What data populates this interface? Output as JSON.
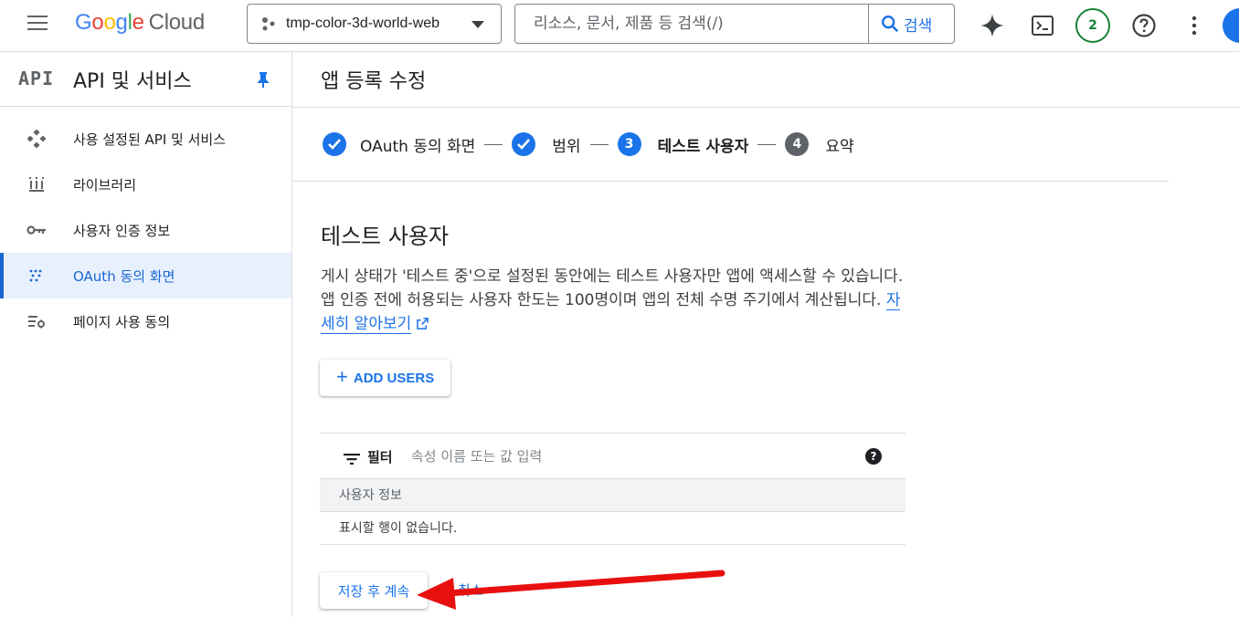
{
  "header": {
    "logo_google": "Google",
    "logo_cloud": "Cloud",
    "project_name": "tmp-color-3d-world-web",
    "search_placeholder": "리소스, 문서, 제품 등 검색(/)",
    "search_button": "검색",
    "notifications_count": "2"
  },
  "sidebar": {
    "api_badge": "API",
    "title": "API 및 서비스",
    "items": [
      {
        "label": "사용 설정된 API 및 서비스",
        "icon": "api-diamond-icon",
        "active": false
      },
      {
        "label": "라이브러리",
        "icon": "library-icon",
        "active": false
      },
      {
        "label": "사용자 인증 정보",
        "icon": "key-icon",
        "active": false
      },
      {
        "label": "OAuth 동의 화면",
        "icon": "oauth-dots-icon",
        "active": true
      },
      {
        "label": "페이지 사용 동의",
        "icon": "settings-list-icon",
        "active": false
      }
    ]
  },
  "main": {
    "page_title": "앱 등록 수정",
    "steps": [
      {
        "label": "OAuth 동의 화면",
        "state": "done"
      },
      {
        "label": "범위",
        "state": "done"
      },
      {
        "label": "테스트 사용자",
        "state": "current",
        "number": "3"
      },
      {
        "label": "요약",
        "state": "pending",
        "number": "4"
      }
    ],
    "section_title": "테스트 사용자",
    "description": "게시 상태가 '테스트 중'으로 설정된 동안에는 테스트 사용자만 앱에 액세스할 수 있습니다. 앱 인증 전에 허용되는 사용자 한도는 100명이며 앱의 전체 수명 주기에서 계산됩니다.",
    "learn_more": "자세히 알아보기",
    "add_users_label": "ADD USERS",
    "filter_label": "필터",
    "filter_placeholder": "속성 이름 또는 값 입력",
    "help_glyph": "?",
    "table_header": "사용자 정보",
    "table_empty": "표시할 행이 없습니다.",
    "save_label": "저장 후 계속",
    "cancel_label": "취소"
  },
  "colors": {
    "accent": "#1a73e8",
    "active_bg": "#e8f0fe",
    "annotation_arrow": "#e8100f"
  }
}
